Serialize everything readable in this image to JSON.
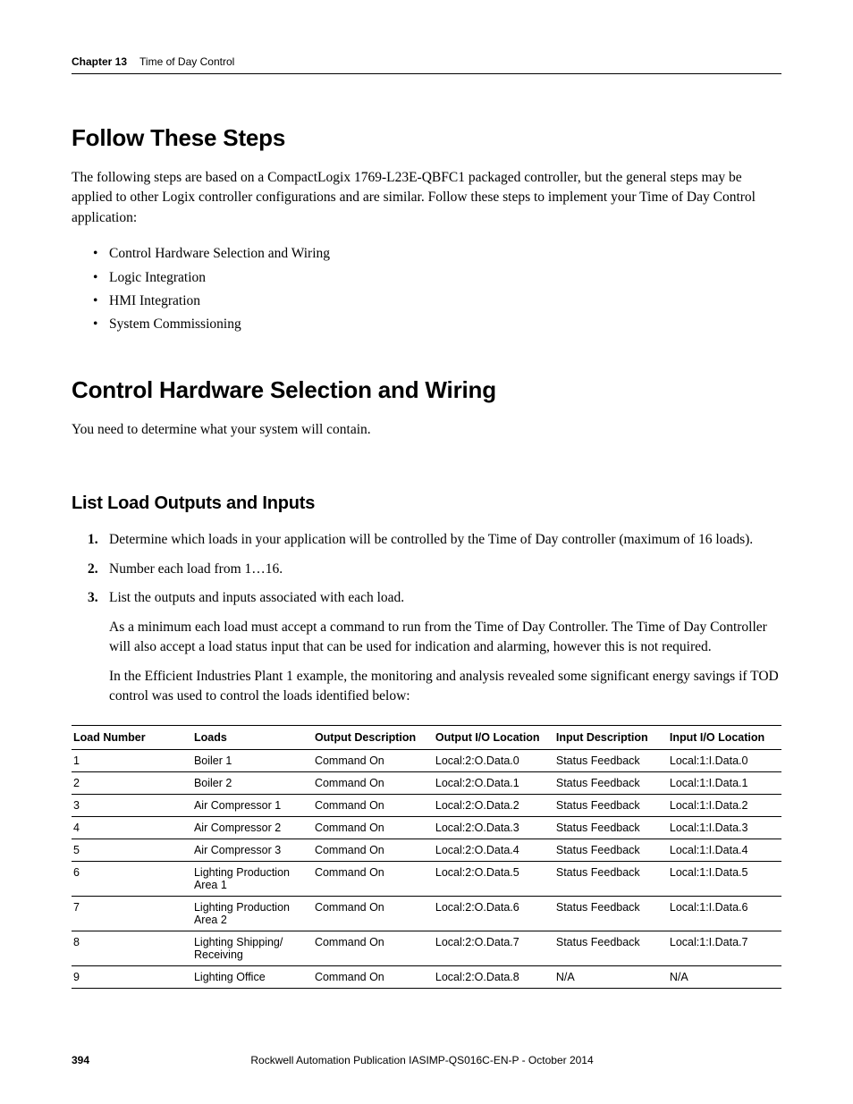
{
  "header": {
    "chapter": "Chapter 13",
    "title": "Time of Day Control"
  },
  "sections": {
    "follow": {
      "heading": "Follow These Steps",
      "intro": "The following steps are based on a CompactLogix 1769-L23E-QBFC1 packaged controller, but the general steps may be applied to other Logix controller configurations and are similar. Follow these steps to implement your Time of Day Control application:",
      "bullets": [
        "Control Hardware Selection and Wiring",
        "Logic Integration",
        "HMI Integration",
        "System Commissioning"
      ]
    },
    "hardware": {
      "heading": "Control Hardware Selection and Wiring",
      "intro": "You need to determine what your system will contain."
    },
    "listloads": {
      "heading": "List Load Outputs and Inputs",
      "steps": [
        "Determine which loads in your application will be controlled by the Time of Day controller (maximum of 16 loads).",
        "Number each load from 1…16.",
        "List the outputs and inputs associated with each load."
      ],
      "step3_paras": [
        "As a minimum each load must accept a command to run from the Time of Day Controller. The Time of Day Controller will also accept a load status input that can be used for indication and alarming, however this is not required.",
        "In the Efficient Industries Plant 1 example, the monitoring and analysis revealed some significant energy savings if TOD control was used to control the loads identified below:"
      ]
    }
  },
  "table": {
    "headers": [
      "Load Number",
      "Loads",
      "Output Description",
      "Output I/O Location",
      "Input Description",
      "Input I/O Location"
    ],
    "rows": [
      [
        "1",
        "Boiler 1",
        "Command On",
        "Local:2:O.Data.0",
        "Status Feedback",
        "Local:1:I.Data.0"
      ],
      [
        "2",
        "Boiler 2",
        "Command On",
        "Local:2:O.Data.1",
        "Status Feedback",
        "Local:1:I.Data.1"
      ],
      [
        "3",
        "Air Compressor 1",
        "Command On",
        "Local:2:O.Data.2",
        "Status Feedback",
        "Local:1:I.Data.2"
      ],
      [
        "4",
        "Air Compressor 2",
        "Command On",
        "Local:2:O.Data.3",
        "Status Feedback",
        "Local:1:I.Data.3"
      ],
      [
        "5",
        "Air Compressor 3",
        "Command On",
        "Local:2:O.Data.4",
        "Status Feedback",
        "Local:1:I.Data.4"
      ],
      [
        "6",
        "Lighting Production Area 1",
        "Command On",
        "Local:2:O.Data.5",
        "Status Feedback",
        "Local:1:I.Data.5"
      ],
      [
        "7",
        "Lighting Production Area 2",
        "Command On",
        "Local:2:O.Data.6",
        "Status Feedback",
        "Local:1:I.Data.6"
      ],
      [
        "8",
        "Lighting Shipping/ Receiving",
        "Command On",
        "Local:2:O.Data.7",
        "Status Feedback",
        "Local:1:I.Data.7"
      ],
      [
        "9",
        "Lighting Office",
        "Command On",
        "Local:2:O.Data.8",
        "N/A",
        "N/A"
      ]
    ]
  },
  "footer": {
    "page": "394",
    "publication": "Rockwell Automation Publication IASIMP-QS016C-EN-P - October 2014"
  }
}
